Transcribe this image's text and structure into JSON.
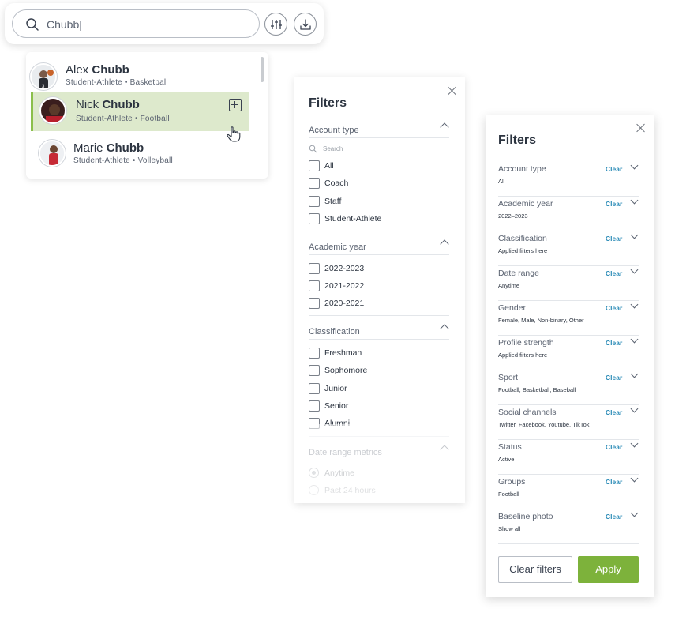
{
  "search": {
    "value": "Chubb|"
  },
  "results": [
    {
      "first": "Alex",
      "last": "Chubb",
      "role": "Student-Athlete",
      "sport": "Basketball"
    },
    {
      "first": "Nick",
      "last": "Chubb",
      "role": "Student-Athlete",
      "sport": "Football"
    },
    {
      "first": "Marie",
      "last": "Chubb",
      "role": "Student-Athlete",
      "sport": "Volleyball"
    }
  ],
  "panel1": {
    "title": "Filters",
    "search_placeholder": "Search",
    "sections": [
      {
        "label": "Account type",
        "options": [
          "All",
          "Coach",
          "Staff",
          "Student-Athlete"
        ]
      },
      {
        "label": "Academic year",
        "options": [
          "2022-2023",
          "2021-2022",
          "2020-2021"
        ]
      },
      {
        "label": "Classification",
        "options": [
          "Freshman",
          "Sophomore",
          "Junior",
          "Senior",
          "Alumni"
        ]
      },
      {
        "label": "Date range metrics",
        "options": [
          "Anytime",
          "Past 24 hours"
        ]
      }
    ]
  },
  "panel2": {
    "title": "Filters",
    "clear_label": "Clear",
    "rows": [
      {
        "label": "Account type",
        "value": "All"
      },
      {
        "label": "Academic year",
        "value": "2022–2023"
      },
      {
        "label": "Classification",
        "value": "Applied filters here"
      },
      {
        "label": "Date range",
        "value": "Anytime"
      },
      {
        "label": "Gender",
        "value": "Female, Male, Non-binary, Other"
      },
      {
        "label": "Profile strength",
        "value": "Applied filters here"
      },
      {
        "label": "Sport",
        "value": "Football, Basketball, Baseball"
      },
      {
        "label": "Social channels",
        "value": "Twitter, Facebook, Youtube, TikTok"
      },
      {
        "label": "Status",
        "value": "Active"
      },
      {
        "label": "Groups",
        "value": "Football"
      },
      {
        "label": "Baseline photo",
        "value": "Show all"
      }
    ],
    "clear_filters_label": "Clear filters",
    "apply_label": "Apply"
  },
  "colors": {
    "accent_green": "#7db23b",
    "highlight": "#dde9cc",
    "link_blue": "#2a8bb7"
  },
  "icons": [
    "search-icon",
    "sliders-icon",
    "download-icon",
    "add-icon",
    "hand-cursor-icon",
    "close-icon",
    "chevron-up-icon",
    "chevron-down-icon"
  ]
}
